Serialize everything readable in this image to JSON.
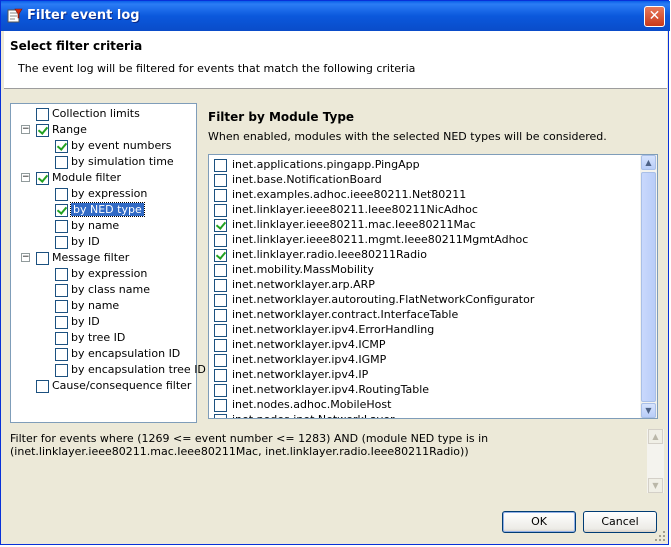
{
  "window": {
    "title": "Filter event log"
  },
  "header": {
    "title": "Select filter criteria",
    "description": "The event log will be filtered for events that match the following criteria"
  },
  "tree": [
    {
      "label": "Collection limits",
      "level": 0,
      "expander": null,
      "checked": false,
      "selected": false
    },
    {
      "label": "Range",
      "level": 0,
      "expander": "minus",
      "checked": true,
      "selected": false
    },
    {
      "label": "by event numbers",
      "level": 1,
      "expander": null,
      "checked": true,
      "selected": false
    },
    {
      "label": "by simulation time",
      "level": 1,
      "expander": null,
      "checked": false,
      "selected": false
    },
    {
      "label": "Module filter",
      "level": 0,
      "expander": "minus",
      "checked": true,
      "selected": false
    },
    {
      "label": "by expression",
      "level": 1,
      "expander": null,
      "checked": false,
      "selected": false
    },
    {
      "label": "by NED type",
      "level": 1,
      "expander": null,
      "checked": true,
      "selected": true
    },
    {
      "label": "by name",
      "level": 1,
      "expander": null,
      "checked": false,
      "selected": false
    },
    {
      "label": "by ID",
      "level": 1,
      "expander": null,
      "checked": false,
      "selected": false
    },
    {
      "label": "Message filter",
      "level": 0,
      "expander": "minus",
      "checked": false,
      "selected": false
    },
    {
      "label": "by expression",
      "level": 1,
      "expander": null,
      "checked": false,
      "selected": false
    },
    {
      "label": "by class name",
      "level": 1,
      "expander": null,
      "checked": false,
      "selected": false
    },
    {
      "label": "by name",
      "level": 1,
      "expander": null,
      "checked": false,
      "selected": false
    },
    {
      "label": "by ID",
      "level": 1,
      "expander": null,
      "checked": false,
      "selected": false
    },
    {
      "label": "by tree ID",
      "level": 1,
      "expander": null,
      "checked": false,
      "selected": false
    },
    {
      "label": "by encapsulation ID",
      "level": 1,
      "expander": null,
      "checked": false,
      "selected": false
    },
    {
      "label": "by encapsulation tree ID",
      "level": 1,
      "expander": null,
      "checked": false,
      "selected": false
    },
    {
      "label": "Cause/consequence filter",
      "level": 0,
      "expander": null,
      "checked": false,
      "selected": false
    }
  ],
  "panel": {
    "title": "Filter by Module Type",
    "description": "When enabled, modules with the selected NED types will be considered."
  },
  "ned_types": [
    {
      "label": "inet.applications.pingapp.PingApp",
      "checked": false
    },
    {
      "label": "inet.base.NotificationBoard",
      "checked": false
    },
    {
      "label": "inet.examples.adhoc.ieee80211.Net80211",
      "checked": false
    },
    {
      "label": "inet.linklayer.ieee80211.Ieee80211NicAdhoc",
      "checked": false
    },
    {
      "label": "inet.linklayer.ieee80211.mac.Ieee80211Mac",
      "checked": true
    },
    {
      "label": "inet.linklayer.ieee80211.mgmt.Ieee80211MgmtAdhoc",
      "checked": false
    },
    {
      "label": "inet.linklayer.radio.Ieee80211Radio",
      "checked": true
    },
    {
      "label": "inet.mobility.MassMobility",
      "checked": false
    },
    {
      "label": "inet.networklayer.arp.ARP",
      "checked": false
    },
    {
      "label": "inet.networklayer.autorouting.FlatNetworkConfigurator",
      "checked": false
    },
    {
      "label": "inet.networklayer.contract.InterfaceTable",
      "checked": false
    },
    {
      "label": "inet.networklayer.ipv4.ErrorHandling",
      "checked": false
    },
    {
      "label": "inet.networklayer.ipv4.ICMP",
      "checked": false
    },
    {
      "label": "inet.networklayer.ipv4.IGMP",
      "checked": false
    },
    {
      "label": "inet.networklayer.ipv4.IP",
      "checked": false
    },
    {
      "label": "inet.networklayer.ipv4.RoutingTable",
      "checked": false
    },
    {
      "label": "inet.nodes.adhoc.MobileHost",
      "checked": false
    },
    {
      "label": "inet.nodes.inet.NetworkLayer",
      "checked": false
    }
  ],
  "summary": {
    "line1": "Filter for events where (1269 <= event number <= 1283) AND (module NED type is in",
    "line2": "(inet.linklayer.ieee80211.mac.Ieee80211Mac, inet.linklayer.radio.Ieee80211Radio))"
  },
  "buttons": {
    "ok": "OK",
    "cancel": "Cancel"
  },
  "icons": {
    "title": "filter-icon",
    "close": "close-icon"
  }
}
